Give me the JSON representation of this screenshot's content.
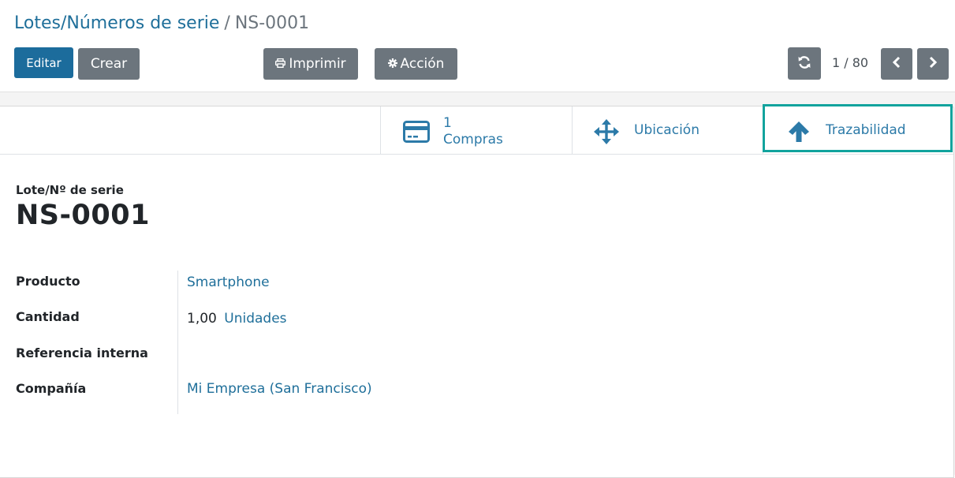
{
  "breadcrumb": {
    "parent": "Lotes/Números de serie",
    "separator": "/",
    "current": "NS-0001"
  },
  "toolbar": {
    "edit_label": "Editar",
    "create_label": "Crear",
    "print_label": "Imprimir",
    "action_label": "Acción",
    "print_icon": "printer-icon",
    "action_icon": "gear-icon"
  },
  "pager": {
    "value": "1 / 80"
  },
  "smart_buttons": [
    {
      "icon": "credit-card-icon",
      "count": "1",
      "label": "Compras"
    },
    {
      "icon": "arrows-move-icon",
      "label": "Ubicación"
    },
    {
      "icon": "arrow-up-icon",
      "label": "Trazabilidad"
    }
  ],
  "record": {
    "name_label": "Lote/Nº de serie",
    "name": "NS-0001"
  },
  "fields": {
    "product": {
      "label": "Producto",
      "value": "Smartphone"
    },
    "quantity": {
      "label": "Cantidad",
      "value": "1,00",
      "uom": "Unidades"
    },
    "internal_ref": {
      "label": "Referencia interna",
      "value": ""
    },
    "company": {
      "label": "Compañía",
      "value": "Mi Empresa (San Francisco)"
    }
  },
  "colors": {
    "primary": "#1c6c9c",
    "secondary": "#6c757d",
    "highlight": "#12a39d"
  }
}
